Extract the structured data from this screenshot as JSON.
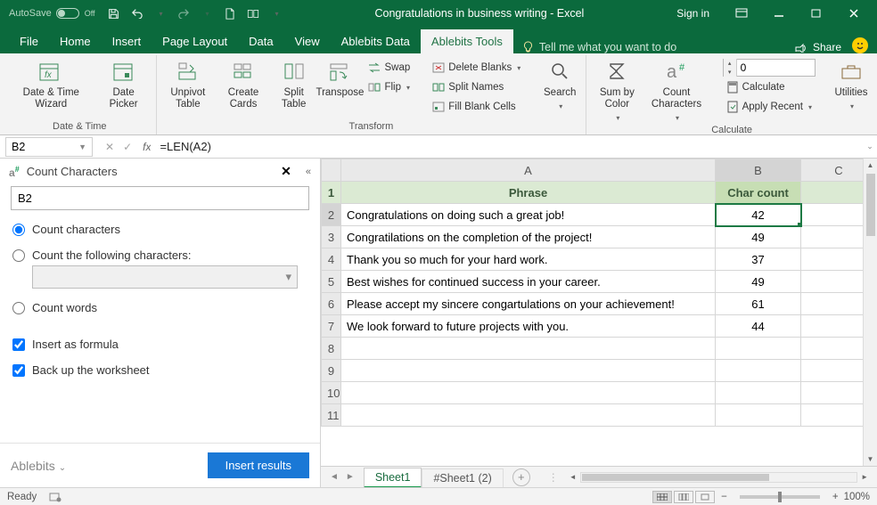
{
  "titlebar": {
    "autosave_label": "AutoSave",
    "autosave_state": "Off",
    "title": "Congratulations in business writing  -  Excel",
    "signin": "Sign in"
  },
  "tabs": {
    "items": [
      "File",
      "Home",
      "Insert",
      "Page Layout",
      "Data",
      "View",
      "Ablebits Data",
      "Ablebits Tools"
    ],
    "active_index": 7,
    "tell_me": "Tell me what you want to do",
    "share": "Share"
  },
  "ribbon": {
    "date_time": {
      "wizard": "Date & Time Wizard",
      "picker": "Date Picker",
      "label": "Date & Time"
    },
    "transform": {
      "unpivot": "Unpivot Table",
      "cards": "Create Cards",
      "split": "Split Table",
      "transpose": "Transpose",
      "swap": "Swap",
      "flip": "Flip",
      "delete_blanks": "Delete Blanks",
      "split_names": "Split Names",
      "fill_blank": "Fill Blank Cells",
      "search": "Search",
      "label": "Transform"
    },
    "calc": {
      "sumby": "Sum by Color",
      "countchar": "Count Characters",
      "numbox_value": "0",
      "calculate": "Calculate",
      "apply": "Apply Recent",
      "utilities": "Utilities",
      "label": "Calculate"
    }
  },
  "formula_bar": {
    "namebox": "B2",
    "formula": "=LEN(A2)"
  },
  "taskpane": {
    "title": "Count Characters",
    "input": "B2",
    "radio_count_chars": "Count characters",
    "radio_count_following": "Count the following characters:",
    "radio_count_words": "Count words",
    "check_formula": "Insert as formula",
    "check_backup": "Back up the worksheet",
    "brand": "Ablebits",
    "action": "Insert results"
  },
  "grid": {
    "cols": [
      "A",
      "B",
      "C"
    ],
    "rows": [
      "1",
      "2",
      "3",
      "4",
      "5",
      "6",
      "7",
      "8",
      "9",
      "10",
      "11"
    ],
    "header": {
      "a": "Phrase",
      "b": "Char count"
    },
    "data": [
      {
        "a": "Congratulations on doing such a great job!",
        "b": "42"
      },
      {
        "a": "Congratilations on the completion of the project!",
        "b": "49"
      },
      {
        "a": "Thank you so much for your hard work.",
        "b": "37"
      },
      {
        "a": "Best wishes for continued success in your career.",
        "b": "49"
      },
      {
        "a": "Please accept my sincere congartulations on your achievement!",
        "b": "61"
      },
      {
        "a": "We look forward to future projects with you.",
        "b": "44"
      }
    ]
  },
  "sheets": {
    "active": "Sheet1",
    "other": "#Sheet1 (2)"
  },
  "statusbar": {
    "ready": "Ready",
    "zoom": "100%"
  }
}
